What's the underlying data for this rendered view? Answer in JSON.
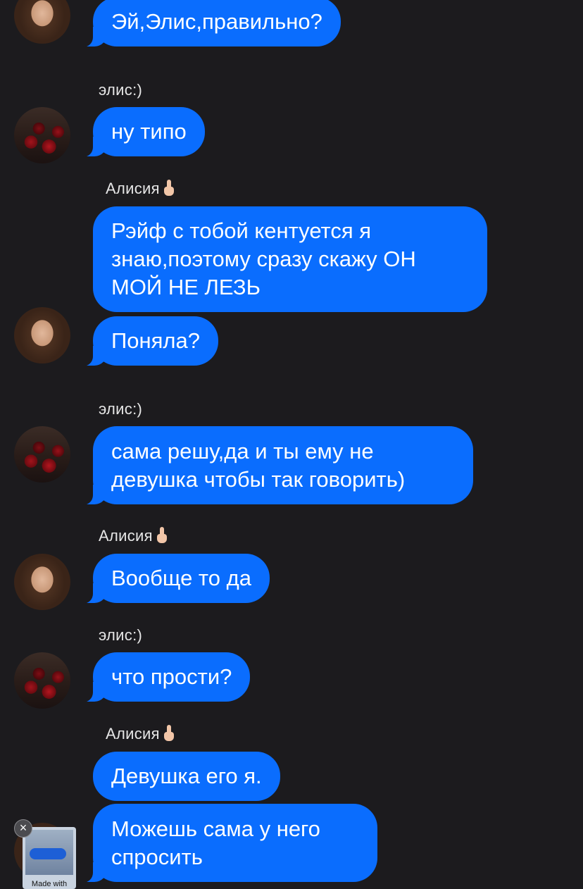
{
  "colors": {
    "background": "#1c1b1e",
    "bubble": "#0a6dfe",
    "bubble_text": "#ffffff",
    "sender_text": "#e6e6e6"
  },
  "messages": [
    {
      "sender": "",
      "avatar": "girl-photo",
      "text_lines": [
        "Эй,Элис,правильно?"
      ]
    },
    {
      "sender": "элис:)",
      "avatar": "roses-photo",
      "text_lines": [
        "ну типо"
      ]
    },
    {
      "sender": "Алисия",
      "sender_emoji": "middle-finger-emoji",
      "avatar": "",
      "text_lines": [
        "Рэйф с тобой кентуется я",
        "знаю,поэтому сразу скажу ОН",
        "МОЙ НЕ ЛЕЗЬ"
      ]
    },
    {
      "sender": "",
      "avatar": "girl-photo",
      "text_lines": [
        "Поняла?"
      ]
    },
    {
      "sender": "элис:)",
      "avatar": "roses-photo",
      "text_lines": [
        "сама решу,да и ты ему не",
        "девушка чтобы так говорить)"
      ]
    },
    {
      "sender": "Алисия",
      "sender_emoji": "middle-finger-emoji",
      "avatar": "girl-photo",
      "text_lines": [
        "Вообще то да"
      ]
    },
    {
      "sender": "элис:)",
      "avatar": "roses-photo",
      "text_lines": [
        "что прости?"
      ]
    },
    {
      "sender": "Алисия",
      "sender_emoji": "middle-finger-emoji",
      "avatar": "",
      "text_lines": [
        "Девушка его я."
      ]
    },
    {
      "sender": "",
      "avatar": "girl-photo",
      "text_lines": [
        "Можешь сама у него",
        "спросить"
      ]
    }
  ],
  "sticker": {
    "caption": "Made with",
    "close_icon": "close-icon"
  }
}
